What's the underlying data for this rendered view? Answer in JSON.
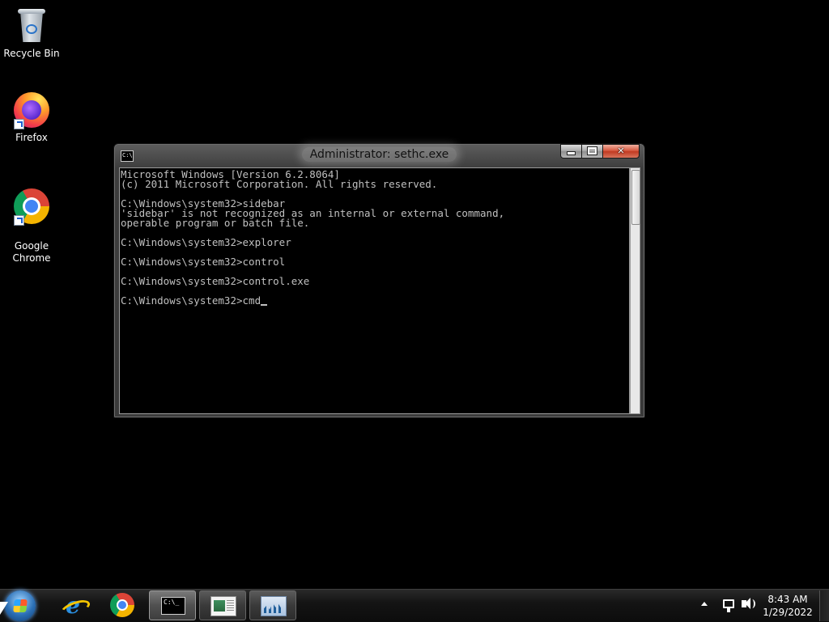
{
  "desktop": {
    "icons": [
      {
        "label": "Recycle Bin",
        "icon": "recycle-bin-icon"
      },
      {
        "label": "Firefox",
        "icon": "firefox-icon"
      },
      {
        "label": "Google\nChrome",
        "icon": "chrome-icon"
      }
    ]
  },
  "window": {
    "title": "Administrator: sethc.exe",
    "icon_text": "C:\\.",
    "close_label": "✕",
    "console_lines": [
      "Microsoft Windows [Version 6.2.8064]",
      "(c) 2011 Microsoft Corporation. All rights reserved.",
      "",
      "C:\\Windows\\system32>sidebar",
      "'sidebar' is not recognized as an internal or external command,",
      "operable program or batch file.",
      "",
      "C:\\Windows\\system32>explorer",
      "",
      "C:\\Windows\\system32>control",
      "",
      "C:\\Windows\\system32>control.exe",
      "",
      "C:\\Windows\\system32>cmd"
    ]
  },
  "taskbar": {
    "items": [
      {
        "name": "internet-explorer",
        "icon": "internet-explorer-icon",
        "state": "pinned"
      },
      {
        "name": "chrome",
        "icon": "chrome-icon",
        "state": "pinned"
      },
      {
        "name": "command-prompt",
        "icon": "command-prompt-icon",
        "state": "active",
        "icon_text": "C:\\_"
      },
      {
        "name": "document-viewer",
        "icon": "document-icon",
        "state": "open"
      },
      {
        "name": "performance-monitor",
        "icon": "performance-monitor-icon",
        "state": "open"
      }
    ],
    "tray": {
      "icons": [
        "show-hidden-icons-icon",
        "network-icon",
        "volume-icon"
      ]
    },
    "clock": {
      "time": "8:43 AM",
      "date": "1/29/2022"
    }
  }
}
